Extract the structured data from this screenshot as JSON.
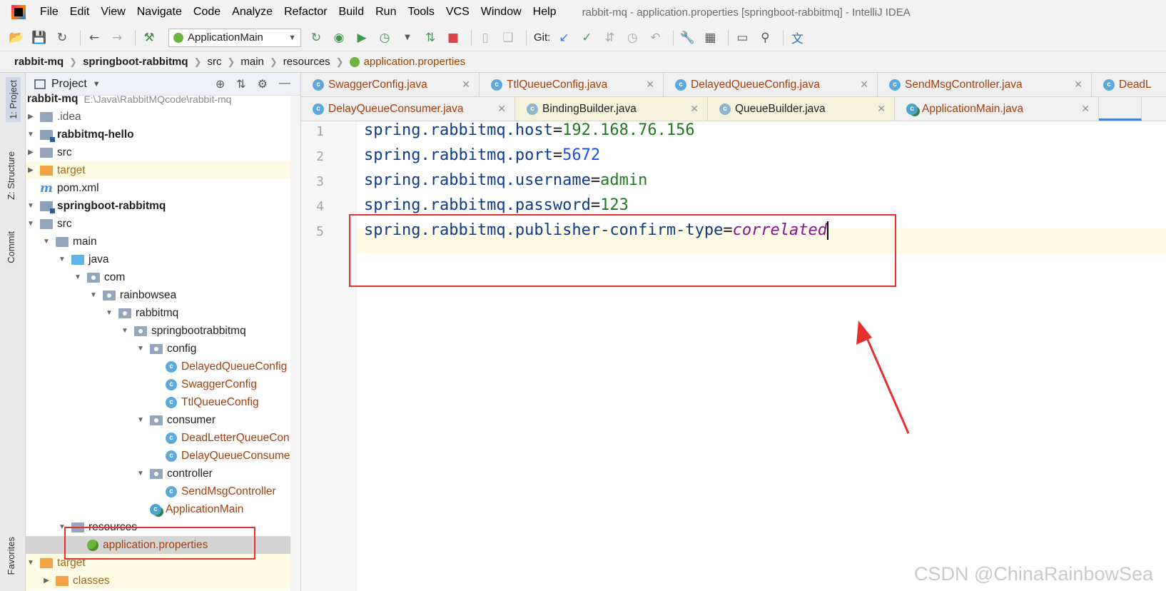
{
  "menubar": {
    "items": [
      "File",
      "Edit",
      "View",
      "Navigate",
      "Code",
      "Analyze",
      "Refactor",
      "Build",
      "Run",
      "Tools",
      "VCS",
      "Window",
      "Help"
    ],
    "window_title": "rabbit-mq - application.properties [springboot-rabbitmq] - IntelliJ IDEA"
  },
  "toolbar": {
    "run_config": "ApplicationMain",
    "git_label": "Git:"
  },
  "breadcrumb": [
    "rabbit-mq",
    "springboot-rabbitmq",
    "src",
    "main",
    "resources",
    "application.properties"
  ],
  "toolstrip": [
    "1: Project",
    "Z: Structure",
    "Commit",
    "Favorites"
  ],
  "project_panel": {
    "title": "Project",
    "tree": [
      {
        "label": "rabbit-mq",
        "extra": "E:\\Java\\RabbitMQcode\\rabbit-mq"
      },
      {
        "label": ".idea"
      },
      {
        "label": "rabbitmq-hello"
      },
      {
        "label": "src"
      },
      {
        "label": "target"
      },
      {
        "label": "pom.xml"
      },
      {
        "label": "springboot-rabbitmq"
      },
      {
        "label": "src"
      },
      {
        "label": "main"
      },
      {
        "label": "java"
      },
      {
        "label": "com"
      },
      {
        "label": "rainbowsea"
      },
      {
        "label": "rabbitmq"
      },
      {
        "label": "springbootrabbitmq"
      },
      {
        "label": "config"
      },
      {
        "label": "DelayedQueueConfig"
      },
      {
        "label": "SwaggerConfig"
      },
      {
        "label": "TtlQueueConfig"
      },
      {
        "label": "consumer"
      },
      {
        "label": "DeadLetterQueueCon"
      },
      {
        "label": "DelayQueueConsumer"
      },
      {
        "label": "controller"
      },
      {
        "label": "SendMsgController"
      },
      {
        "label": "ApplicationMain"
      },
      {
        "label": "resources"
      },
      {
        "label": "application.properties"
      },
      {
        "label": "target"
      },
      {
        "label": "classes"
      }
    ]
  },
  "tabs_row1": [
    "SwaggerConfig.java",
    "TtlQueueConfig.java",
    "DelayedQueueConfig.java",
    "SendMsgController.java",
    "DeadL"
  ],
  "tabs_row2": [
    "DelayQueueConsumer.java",
    "BindingBuilder.java",
    "QueueBuilder.java",
    "ApplicationMain.java"
  ],
  "editor": {
    "lines": [
      {
        "num": "1",
        "key": "spring.rabbitmq.host",
        "eq": "=",
        "value": "192.168.76.156"
      },
      {
        "num": "2",
        "key": "spring.rabbitmq.port",
        "eq": "=",
        "value": "5672"
      },
      {
        "num": "3",
        "key": "spring.rabbitmq.username",
        "eq": "=",
        "value": "admin"
      },
      {
        "num": "4",
        "key": "spring.rabbitmq.password",
        "eq": "=",
        "value": "123"
      },
      {
        "num": "5",
        "key": "spring.rabbitmq.publisher-confirm-type",
        "eq": "=",
        "value": "correlated"
      }
    ]
  },
  "watermark": "CSDN @ChinaRainbowSea",
  "colors": {
    "annotation_red": "#e53030",
    "class_name": "#a2400d",
    "property_key": "#0e3a8a",
    "enum_value": "#871094"
  }
}
